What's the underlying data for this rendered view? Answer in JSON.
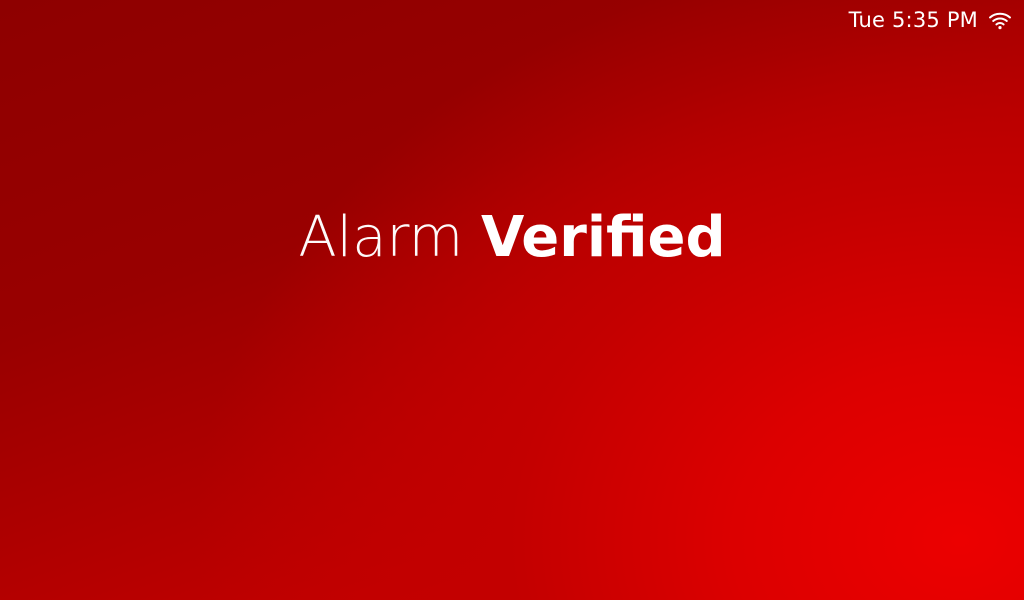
{
  "status_bar": {
    "time": "Tue 5:35 PM",
    "wifi_icon": "wifi-icon"
  },
  "message": {
    "word1": "Alarm",
    "word2": "Verified"
  },
  "colors": {
    "background_dark": "#8e0000",
    "background_bright": "#ec0000",
    "text": "#ffffff"
  }
}
